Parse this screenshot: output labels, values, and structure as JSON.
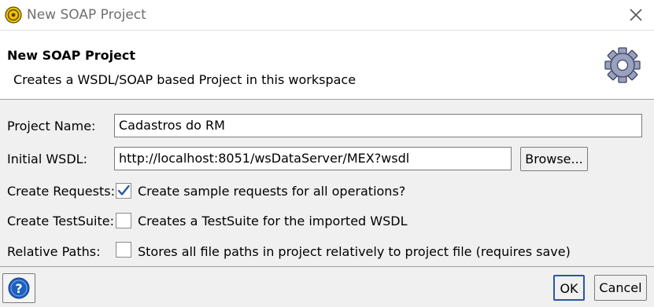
{
  "window": {
    "title": "New SOAP Project"
  },
  "header": {
    "title": "New SOAP Project",
    "description": "Creates a WSDL/SOAP based Project in this workspace"
  },
  "form": {
    "project_name": {
      "label": "Project Name:",
      "value": "Cadastros do RM"
    },
    "initial_wsdl": {
      "label": "Initial WSDL:",
      "value": "http://localhost:8051/wsDataServer/MEX?wsdl"
    },
    "browse_label": "Browse...",
    "create_requests": {
      "label": "Create Requests:",
      "text": "Create sample requests for all operations?",
      "checked": true
    },
    "create_testsuite": {
      "label": "Create TestSuite:",
      "text": "Creates a TestSuite for the imported WSDL",
      "checked": false
    },
    "relative_paths": {
      "label": "Relative Paths:",
      "text": "Stores all file paths in project relatively to project file (requires save)",
      "checked": false
    }
  },
  "footer": {
    "ok_label": "OK",
    "cancel_label": "Cancel"
  },
  "icons": {
    "app": "soapui-icon",
    "close": "close-icon",
    "header": "gear-icon",
    "help": "help-icon",
    "check": "checkmark-icon"
  },
  "colors": {
    "accent": "#2b579a",
    "help_blue": "#1e5fbf",
    "gear": "#8c94b4"
  }
}
